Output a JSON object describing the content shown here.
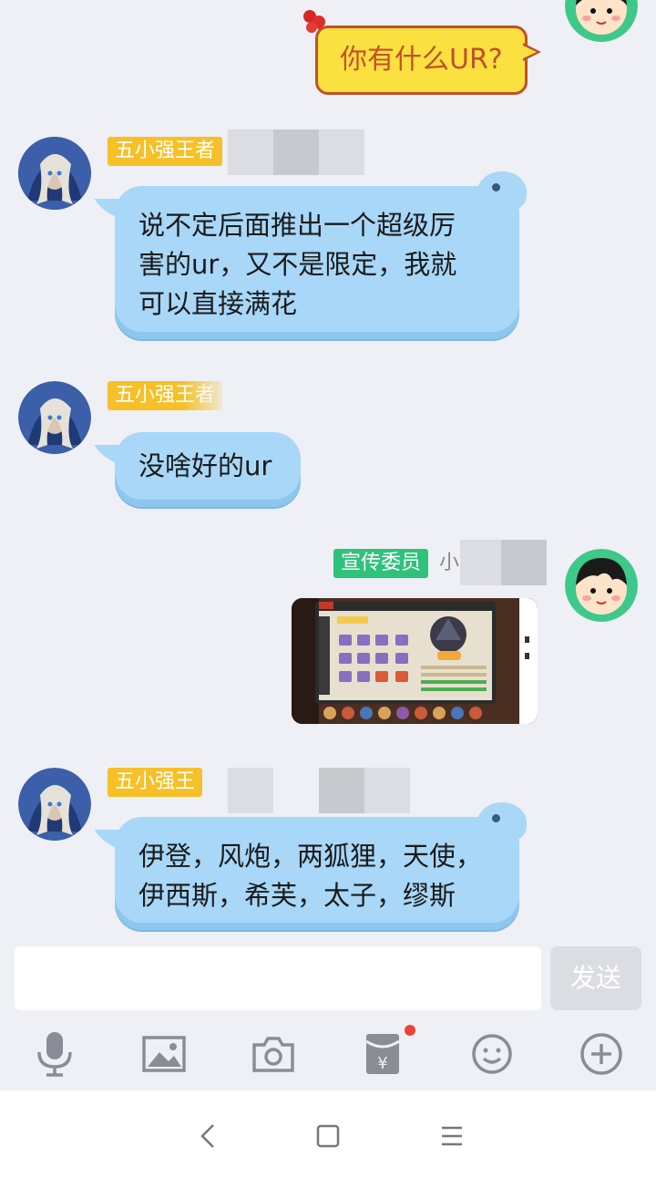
{
  "messages": [
    {
      "type": "text",
      "side": "right",
      "text": "你有什么UR?"
    },
    {
      "type": "text",
      "side": "left",
      "sender_tag": "五小强王者",
      "text": "说不定后面推出一个超级厉\n害的ur，又不是限定，我就\n可以直接满花"
    },
    {
      "type": "text",
      "side": "left",
      "sender_tag": "五小强王者",
      "text": "没啥好的ur"
    },
    {
      "type": "image",
      "side": "right",
      "sender_tag": "宣传委员",
      "sender_name": "小作"
    },
    {
      "type": "text",
      "side": "left",
      "sender_tag": "五小强王",
      "text": "伊登，风炮，两狐狸，天使，\n伊西斯，希芙，太子，缪斯"
    }
  ],
  "composer": {
    "placeholder": "",
    "send_label": "发送"
  },
  "toolbar": {
    "icons": [
      "microphone-icon",
      "image-icon",
      "camera-icon",
      "red-packet-icon",
      "emoji-icon",
      "plus-icon"
    ]
  },
  "colors": {
    "chat_background": "#eef0f6",
    "blue_bubble": "#a8d7f7",
    "yellow_bubble": "#fbe13f",
    "yellow_bubble_text": "#c2502a",
    "tag_yellow": "#f6c028",
    "tag_green": "#2ec27a",
    "badge_red": "#f04134"
  }
}
